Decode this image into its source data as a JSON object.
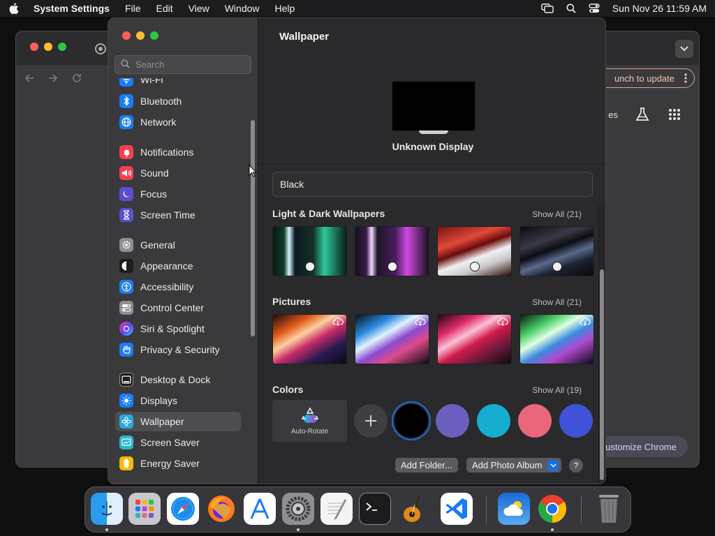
{
  "menubar": {
    "app_name": "System Settings",
    "menus": [
      "File",
      "Edit",
      "View",
      "Window",
      "Help"
    ],
    "clock": "Sun Nov 26  11:59 AM"
  },
  "chrome": {
    "update_label": "unch to update",
    "partial_label": "es",
    "customize_label": "ustomize Chrome"
  },
  "settings": {
    "search_placeholder": "Search",
    "sidebar": {
      "items": [
        {
          "label": "Wi-Fi",
          "icon": "wifi-icon",
          "color": "#1a7cf5"
        },
        {
          "label": "Bluetooth",
          "icon": "bluetooth-icon",
          "color": "#1a7cf5"
        },
        {
          "label": "Network",
          "icon": "globe-icon",
          "color": "#1a7cf5"
        },
        {
          "label": "Notifications",
          "icon": "bell-icon",
          "color": "#f0414e"
        },
        {
          "label": "Sound",
          "icon": "speaker-icon",
          "color": "#f0414e"
        },
        {
          "label": "Focus",
          "icon": "moon-icon",
          "color": "#5b4fd0"
        },
        {
          "label": "Screen Time",
          "icon": "hourglass-icon",
          "color": "#5b4fd0"
        },
        {
          "label": "General",
          "icon": "gear-icon",
          "color": "#8e8e93"
        },
        {
          "label": "Appearance",
          "icon": "appearance-icon",
          "color": "#1c1c1e"
        },
        {
          "label": "Accessibility",
          "icon": "accessibility-icon",
          "color": "#1a7cf5"
        },
        {
          "label": "Control Center",
          "icon": "toggles-icon",
          "color": "#8e8e93"
        },
        {
          "label": "Siri & Spotlight",
          "icon": "siri-icon",
          "color": "#b44ad6"
        },
        {
          "label": "Privacy & Security",
          "icon": "hand-icon",
          "color": "#1a7cf5"
        },
        {
          "label": "Desktop & Dock",
          "icon": "dock-icon",
          "color": "#1c1c1e"
        },
        {
          "label": "Displays",
          "icon": "sun-icon",
          "color": "#1a7cf5"
        },
        {
          "label": "Wallpaper",
          "icon": "flower-icon",
          "color": "#2aa7e0"
        },
        {
          "label": "Screen Saver",
          "icon": "screensaver-icon",
          "color": "#2ab6c8"
        },
        {
          "label": "Energy Saver",
          "icon": "battery-icon",
          "color": "#f5b90a"
        }
      ],
      "selected": "Wallpaper"
    },
    "detail": {
      "title": "Wallpaper",
      "display_name": "Unknown Display",
      "current_wallpaper": "Black",
      "sections": [
        {
          "title": "Light & Dark Wallpapers",
          "show_all": "Show All (21)"
        },
        {
          "title": "Pictures",
          "show_all": "Show All (21)"
        },
        {
          "title": "Colors",
          "show_all": "Show All (19)"
        }
      ],
      "auto_rotate_label": "Auto-Rotate",
      "colors": [
        "#000000",
        "#6b5fc0",
        "#16aed0",
        "#e8677a",
        "#4052d8"
      ],
      "add_folder": "Add Folder...",
      "add_photo_album": "Add Photo Album",
      "help": "?"
    }
  },
  "dock": {
    "apps": [
      "finder",
      "launchpad",
      "safari",
      "firefox",
      "app-store",
      "system-settings",
      "textedit",
      "terminal",
      "garageband",
      "vscode",
      "weather",
      "chrome",
      "trash"
    ]
  }
}
